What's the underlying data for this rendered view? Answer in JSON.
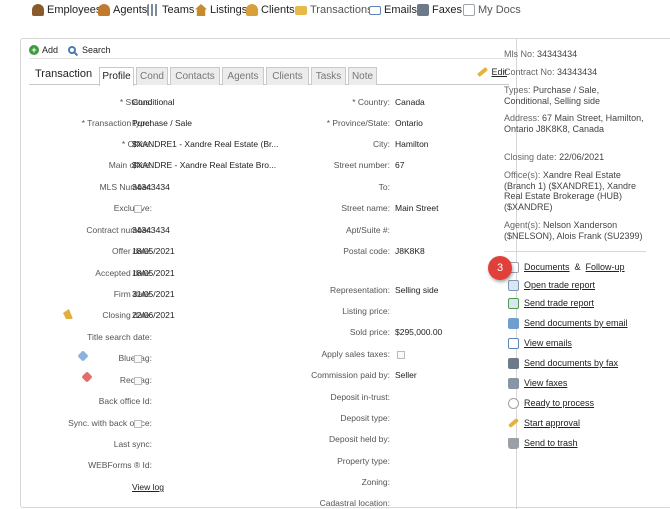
{
  "topnav": {
    "items": [
      {
        "label": "Employees",
        "icon": "employees-icon",
        "color": "#8a5a2b"
      },
      {
        "label": "Agents",
        "icon": "agents-icon",
        "color": "#c07a2c"
      },
      {
        "label": "Teams",
        "icon": "teams-icon",
        "color": "#7c8a99"
      },
      {
        "label": "Listings",
        "icon": "house-icon",
        "color": "#c78a2c"
      },
      {
        "label": "Clients",
        "icon": "clients-icon",
        "color": "#d9a03a"
      },
      {
        "label": "Transactions",
        "icon": "folder-icon",
        "color": "#e6b948"
      },
      {
        "label": "Emails",
        "icon": "envelope-icon",
        "color": "#5b84b8"
      },
      {
        "label": "Faxes",
        "icon": "printer-icon",
        "color": "#6c7a8a"
      },
      {
        "label": "My Docs",
        "icon": "document-icon",
        "color": "#9aa5b1"
      }
    ]
  },
  "toolbar": {
    "add_label": "Add",
    "search_label": "Search"
  },
  "tabs": {
    "title": "Transaction",
    "items": [
      "Profile",
      "Cond",
      "Contacts",
      "Agents",
      "Clients",
      "Tasks",
      "Note"
    ],
    "active": "Profile",
    "edit_label": "Edit"
  },
  "left_fields": [
    {
      "label": "* Status:",
      "value": "Conditional"
    },
    {
      "label": "* Transaction type:",
      "value": "Purchase / Sale"
    },
    {
      "label": "* Office:",
      "value": "$XANDRE1 - Xandre Real Estate (Br..."
    },
    {
      "label": "Main office:",
      "value": "$XANDRE - Xandre Real Estate Bro..."
    },
    {
      "label": "MLS Number:",
      "value": "34343434"
    },
    {
      "label": "Exclusive:",
      "value": ""
    },
    {
      "label": "Contract number:",
      "value": "34343434"
    },
    {
      "label": "Offer date:",
      "value": "18/05/2021"
    },
    {
      "label": "Accepted date:",
      "value": "18/05/2021"
    },
    {
      "label": "Firm date:",
      "value": "31/05/2021"
    },
    {
      "label": "Closing date:",
      "value": "22/06/2021"
    },
    {
      "label": "Title search date:",
      "value": ""
    },
    {
      "label": "Blue tag:",
      "value": ""
    },
    {
      "label": "Red tag:",
      "value": ""
    },
    {
      "label": "Back office Id:",
      "value": ""
    },
    {
      "label": "Sync. with back office:",
      "value": ""
    },
    {
      "label": "Last sync:",
      "value": ""
    },
    {
      "label": "WEBForms ® Id:",
      "value": ""
    }
  ],
  "view_log_label": "View log",
  "right_fields": [
    {
      "label": "* Country:",
      "value": "Canada"
    },
    {
      "label": "* Province/State:",
      "value": "Ontario"
    },
    {
      "label": "City:",
      "value": "Hamilton"
    },
    {
      "label": "Street number:",
      "value": "67"
    },
    {
      "label": "To:",
      "value": ""
    },
    {
      "label": "Street name:",
      "value": "Main Street"
    },
    {
      "label": "Apt/Suite #:",
      "value": ""
    },
    {
      "label": "Postal code:",
      "value": "J8K8K8"
    },
    {
      "label": "Representation:",
      "value": "Selling side"
    },
    {
      "label": "Listing price:",
      "value": ""
    },
    {
      "label": "Sold price:",
      "value": "$295,000.00"
    },
    {
      "label": "Apply sales taxes:",
      "value": ""
    },
    {
      "label": "Commission paid by:",
      "value": "Seller"
    },
    {
      "label": "Deposit in-trust:",
      "value": ""
    },
    {
      "label": "Deposit type:",
      "value": ""
    },
    {
      "label": "Deposit held by:",
      "value": ""
    },
    {
      "label": "Property type:",
      "value": ""
    },
    {
      "label": "Zoning:",
      "value": ""
    },
    {
      "label": "Cadastral location:",
      "value": ""
    }
  ],
  "summary": {
    "mls": {
      "label": "Mls No:",
      "value": "34343434"
    },
    "contract": {
      "label": "Contract No:",
      "value": "34343434"
    },
    "types": {
      "label": "Types:",
      "value": "Purchase / Sale, Conditional, Selling side"
    },
    "address": {
      "label": "Address:",
      "value": "67 Main Street, Hamilton, Ontario J8K8K8, Canada"
    },
    "closing": {
      "label": "Closing date:",
      "value": "22/06/2021"
    },
    "offices": {
      "label": "Office(s):",
      "value": "Xandre Real Estate (Branch 1) ($XANDRE1), Xandre Real Estate Brokerage (HUB) ($XANDRE)"
    },
    "agents": {
      "label": "Agent(s):",
      "value": "Nelson Xanderson ($NELSON), Alois Frank (SU2399)"
    }
  },
  "actions": {
    "documents": "Documents",
    "amp": "&",
    "followup": "Follow-up",
    "open_trade": "Open trade report",
    "send_trade": "Send trade report",
    "send_docs_email": "Send documents by email",
    "view_emails": "View emails",
    "send_docs_fax": "Send documents by fax",
    "view_faxes": "View faxes",
    "ready": "Ready to process",
    "start_approval": "Start approval",
    "send_trash": "Send to trash"
  },
  "badge": "3"
}
